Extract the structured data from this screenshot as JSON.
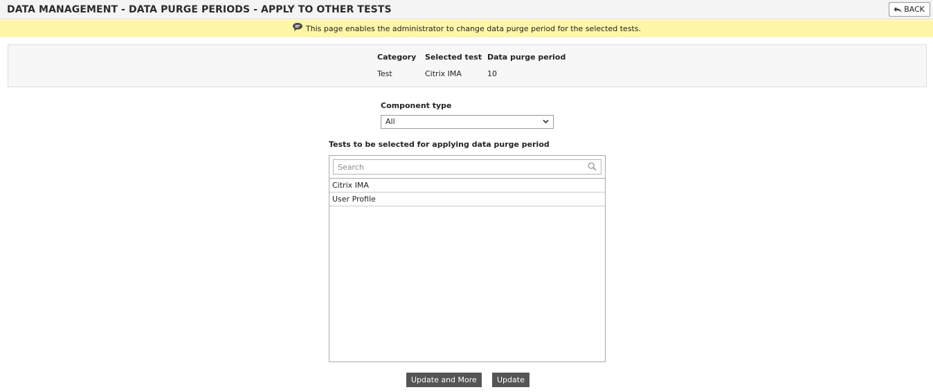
{
  "header": {
    "title": "DATA MANAGEMENT - DATA PURGE PERIODS - APPLY TO OTHER TESTS",
    "back_label": "BACK"
  },
  "info": {
    "message": "This page enables the administrator to change data purge period for the selected tests.",
    "icon": "speech-bubble-icon"
  },
  "summary": {
    "headers": [
      "Category",
      "Selected test",
      "Data purge period"
    ],
    "values": [
      "Test",
      "Citrix IMA",
      "10"
    ]
  },
  "component_type": {
    "label": "Component type",
    "selected": "All"
  },
  "tests": {
    "label": "Tests to be selected for applying data purge period",
    "search_placeholder": "Search",
    "items": [
      "Citrix IMA",
      "User Profile"
    ]
  },
  "actions": {
    "update_more_label": "Update and More",
    "update_label": "Update",
    "button_color": "#555555"
  },
  "colors": {
    "info_bar": "#fff6a8",
    "title_bar": "#f4f4f4"
  }
}
